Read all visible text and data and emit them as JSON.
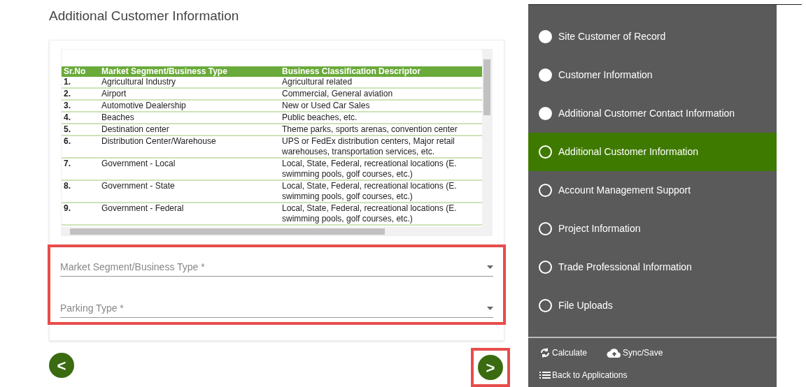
{
  "title": "Additional Customer Information",
  "table": {
    "columns": [
      "Sr.No",
      "Market Segment/Business Type",
      "Business Classification Descriptor"
    ],
    "rows": [
      {
        "no": "1.",
        "type": "Agricultural Industry",
        "descriptor": [
          "Agricultural related"
        ]
      },
      {
        "no": "2.",
        "type": "Airport",
        "descriptor": [
          "Commercial, General aviation"
        ]
      },
      {
        "no": "3.",
        "type": "Automotive Dealership",
        "descriptor": [
          "New or Used Car Sales"
        ]
      },
      {
        "no": "4.",
        "type": "Beaches",
        "descriptor": [
          "Public beaches, etc."
        ]
      },
      {
        "no": "5.",
        "type": "Destination center",
        "descriptor": [
          "Theme parks, sports arenas, convention center"
        ]
      },
      {
        "no": "6.",
        "type": "Distribution Center/Warehouse",
        "descriptor": [
          "UPS or FedEx distribution centers, Major retail",
          "warehouses, transportation services, etc."
        ]
      },
      {
        "no": "7.",
        "type": "Government - Local",
        "descriptor": [
          "Local, State, Federal, recreational locations (E.",
          "swimming pools, golf courses, etc.)"
        ]
      },
      {
        "no": "8.",
        "type": "Government - State",
        "descriptor": [
          "Local, State, Federal, recreational locations (E.",
          "swimming pools, golf courses, etc.)"
        ]
      },
      {
        "no": "9.",
        "type": "Government - Federal",
        "descriptor": [
          "Local, State, Federal, recreational locations (E.",
          "swimming pools, golf courses, etc.)"
        ]
      }
    ]
  },
  "fields": [
    {
      "placeholder": "Market Segment/Business Type *"
    },
    {
      "placeholder": "Parking Type *"
    }
  ],
  "nav": {
    "back": "<",
    "next": ">"
  },
  "steps": [
    {
      "label": "Site Customer of Record",
      "done": true,
      "selected": false
    },
    {
      "label": "Customer Information",
      "done": true,
      "selected": false
    },
    {
      "label": "Additional Customer Contact Information",
      "done": true,
      "selected": false
    },
    {
      "label": "Additional Customer Information",
      "done": false,
      "selected": true
    },
    {
      "label": "Account Management Support",
      "done": false,
      "selected": false
    },
    {
      "label": "Project Information",
      "done": false,
      "selected": false
    },
    {
      "label": "Trade Professional Information",
      "done": false,
      "selected": false
    },
    {
      "label": "File Uploads",
      "done": false,
      "selected": false
    }
  ],
  "footer": {
    "calculate": "Calculate",
    "sync": "Sync/Save",
    "back": "Back to Applications"
  }
}
